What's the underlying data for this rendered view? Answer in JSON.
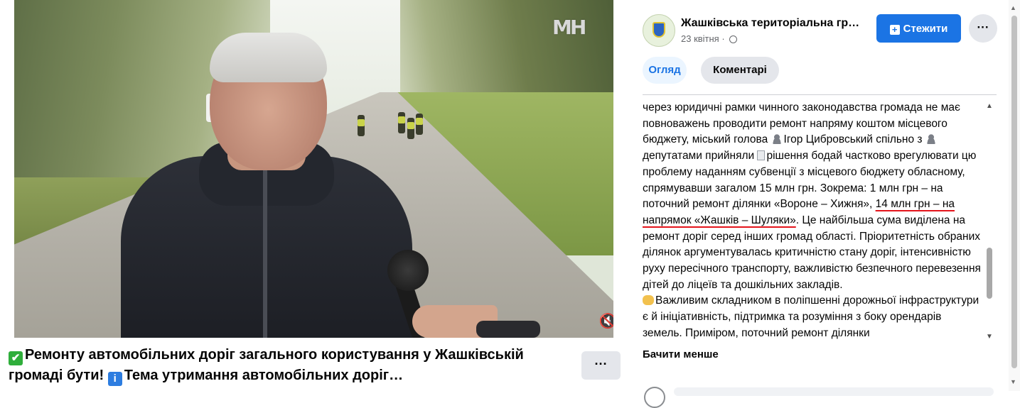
{
  "video": {
    "watermark": "МН",
    "title_part1": "Ремонту автомобільних доріг загального користування у Жашківській громаді бути!",
    "title_part2": "Тема утримання автомобільних доріг…",
    "check_emoji": "✔",
    "info_emoji": "i",
    "more_label": "···",
    "mute_icon": "🔇"
  },
  "post": {
    "page_name": "Жашківська територіальна гро…",
    "date": "23 квітня",
    "follow_label": "Стежити",
    "more_label": "···",
    "tabs": [
      {
        "label": "Огляд",
        "active": true
      },
      {
        "label": "Коментарі",
        "active": false
      }
    ],
    "text": {
      "l1": "через юридичні рамки чинного законодавства громада не має повноважень проводити ремонт напряму коштом місцевого бюджету, міський голова ",
      "mayor": "Ігор Цибровський",
      "l2": " спільно з ",
      "deputies": "депутатами прийняли ",
      "decision": "рішення бодай частково врегулювати цю проблему наданням субвенції з місцевого бюджету обласному, спрямувавши загалом 15 млн грн. Зокрема: 1 млн грн – на поточний ремонт ділянки «Вороне – Хижня», ",
      "highlight": "14 млн грн – на напрямок «Жашків – Шуляки»",
      "rest": ". Це найбільша сума виділена на ремонт доріг серед інших громад області. Пріоритетність обраних ділянок аргументувалась критичністю стану доріг, інтенсивністю руху пересічного транспорту, важливістю безпечного перевезення дітей до ліцеїв та дошкільних закладів.",
      "p2_start": "Важливим складником в поліпшенні дорожньої інфраструктури є й ініціативність, підтримка та розуміння з боку орендарів земель. Приміром, поточний ремонт ділянки"
    },
    "read_less": "Бачити менше"
  },
  "colors": {
    "accent": "#1b74e4",
    "underline": "#e4141b",
    "button_gray": "#e4e6eb"
  }
}
